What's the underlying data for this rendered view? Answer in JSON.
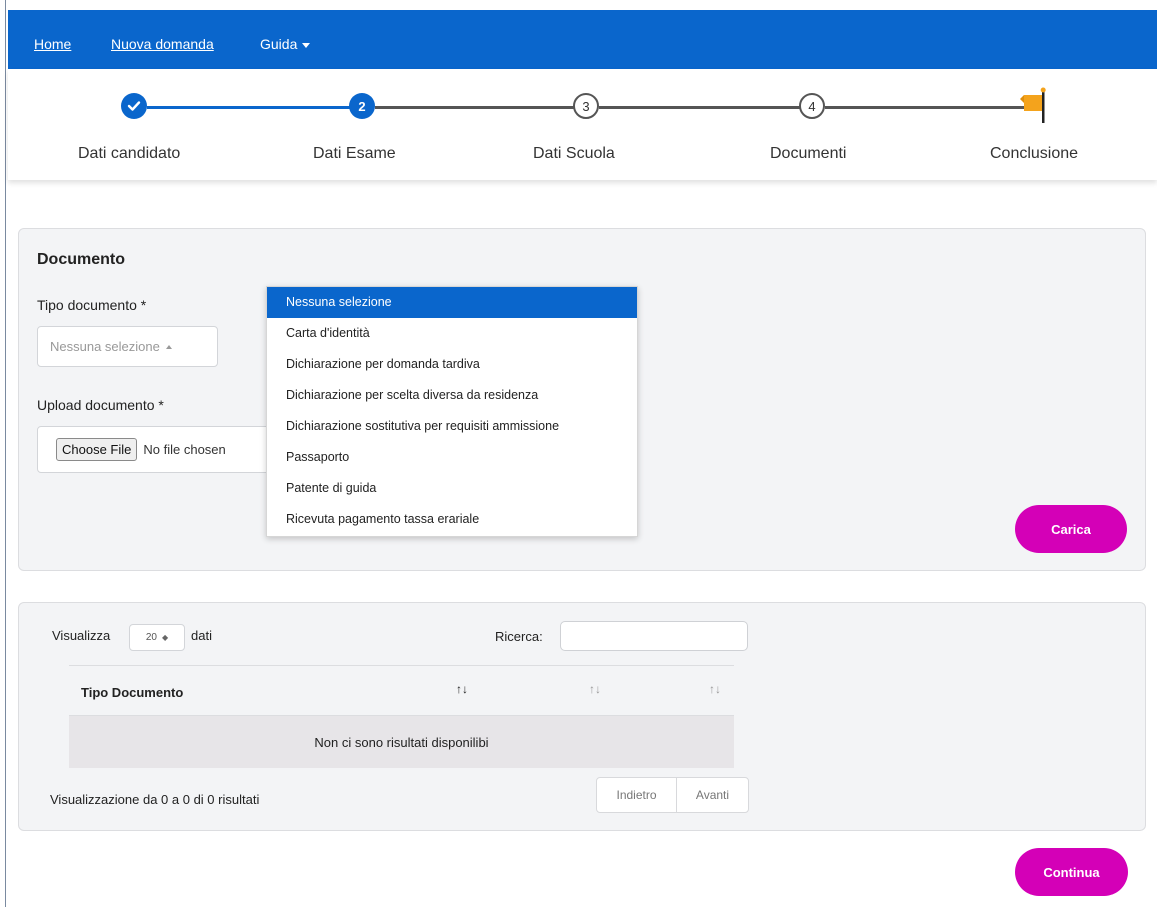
{
  "nav": {
    "home": "Home",
    "new_application": "Nuova domanda",
    "guide": "Guida"
  },
  "stepper": {
    "steps": [
      {
        "label": "Dati candidato",
        "number": "",
        "state": "done"
      },
      {
        "label": "Dati Esame",
        "number": "2",
        "state": "active"
      },
      {
        "label": "Dati Scuola",
        "number": "3",
        "state": "todo"
      },
      {
        "label": "Documenti",
        "number": "4",
        "state": "todo"
      },
      {
        "label": "Conclusione",
        "number": "",
        "state": "final"
      }
    ],
    "colors": {
      "active": "#0a66cc",
      "inactive": "#555555",
      "flag": "#f4a31c"
    }
  },
  "document_form": {
    "title": "Documento",
    "type_label": "Tipo documento *",
    "type_value": "Nessuna selezione",
    "upload_label": "Upload documento *",
    "file_button": "Choose File",
    "file_status": "No file chosen",
    "dropdown_options": [
      "Nessuna selezione",
      "Carta d'identità",
      "Dichiarazione per domanda tardiva",
      "Dichiarazione per scelta diversa da residenza",
      "Dichiarazione sostitutiva per requisiti ammissione",
      "Passaporto",
      "Patente di guida",
      "Ricevuta pagamento tassa erariale"
    ],
    "upload_button": "Carica"
  },
  "documents_table": {
    "show_label": "Visualizza",
    "page_length": "20",
    "entries_label": "dati",
    "search_label": "Ricerca:",
    "search_value": "",
    "column_header": "Tipo Documento",
    "empty_message": "Non ci sono risultati disponilibi",
    "info": "Visualizzazione da 0 a 0 di 0 risultati",
    "prev": "Indietro",
    "next": "Avanti"
  },
  "footer": {
    "continue_button": "Continua"
  },
  "colors": {
    "brand_blue": "#0a66cc",
    "accent_magenta": "#d400b7"
  }
}
